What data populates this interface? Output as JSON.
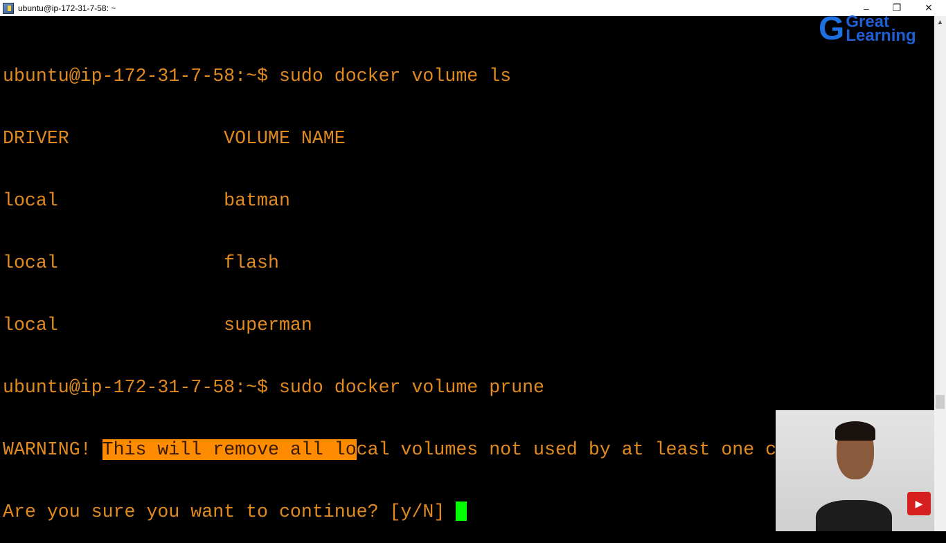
{
  "window": {
    "title": "ubuntu@ip-172-31-7-58: ~",
    "controls": {
      "minimize": "–",
      "restore": "❐",
      "close": "✕"
    }
  },
  "terminal": {
    "lines": [
      "ubuntu@ip-172-31-7-58:~$ sudo docker volume ls",
      "DRIVER              VOLUME NAME",
      "local               batman",
      "local               flash",
      "local               superman",
      "ubuntu@ip-172-31-7-58:~$ sudo docker volume prune"
    ],
    "warning": {
      "prefix": "WARNING! ",
      "highlighted": "This will remove all lo",
      "rest": "cal volumes not used by at least one container."
    },
    "prompt": "Are you sure you want to continue? [y/N] ",
    "text_color": "#e08a20",
    "highlight_color": "#ff8c00",
    "cursor_color": "#00ff00"
  },
  "logo": {
    "text_line1": "Great",
    "text_line2": "Learning",
    "color": "#1e5fd6"
  },
  "webcam": {
    "subscribe_icon": "youtube-subscribe-icon"
  }
}
